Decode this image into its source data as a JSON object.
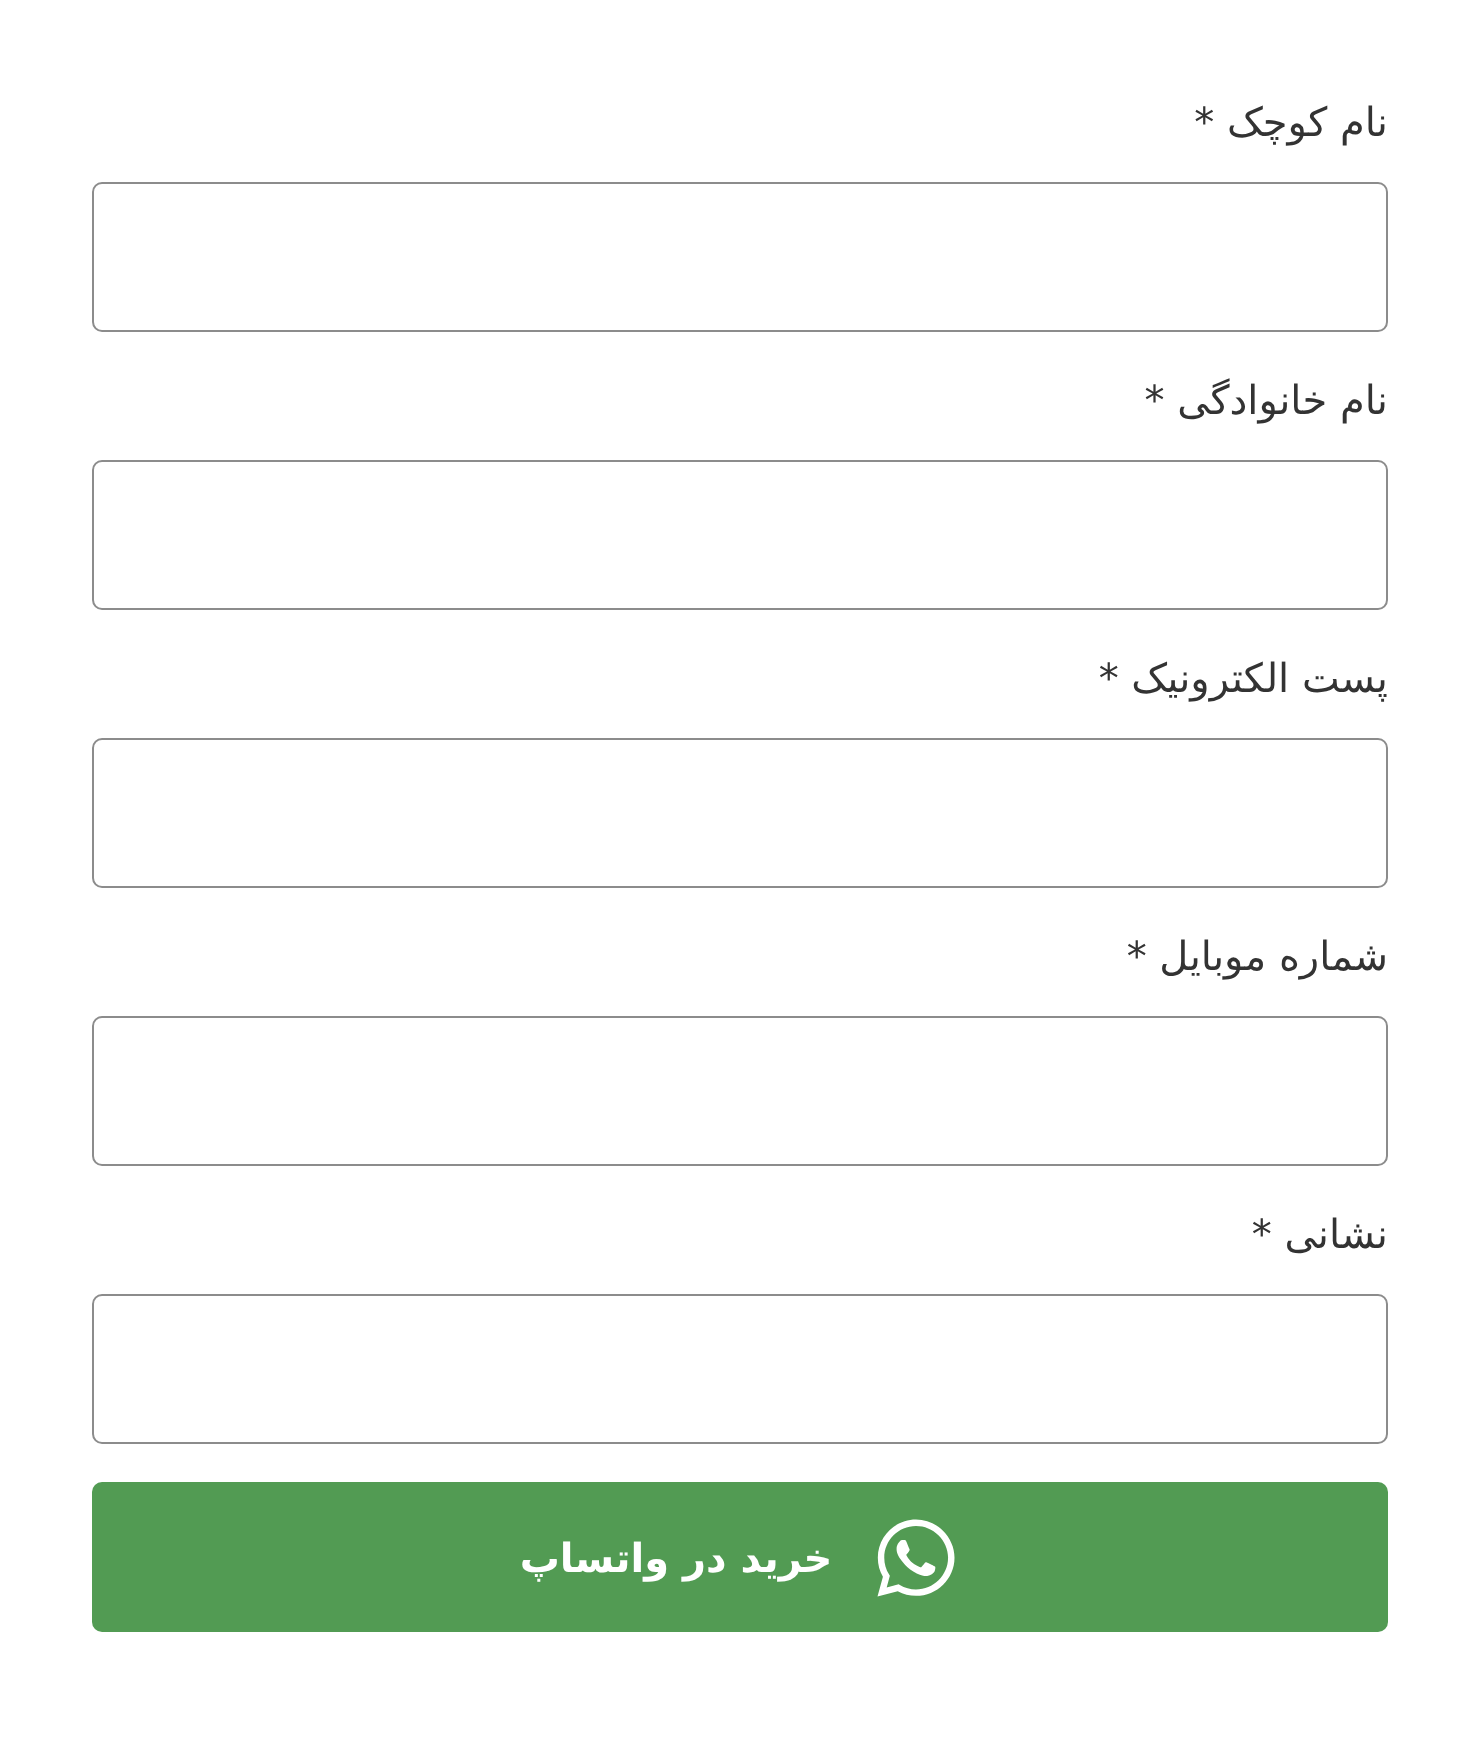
{
  "fields": [
    {
      "label": "نام کوچک *"
    },
    {
      "label": "نام خانوادگی *"
    },
    {
      "label": "پست الکترونیک *"
    },
    {
      "label": "شماره موبایل *"
    },
    {
      "label": "نشانی *"
    }
  ],
  "submit_button": {
    "label": "خرید در واتساپ"
  }
}
